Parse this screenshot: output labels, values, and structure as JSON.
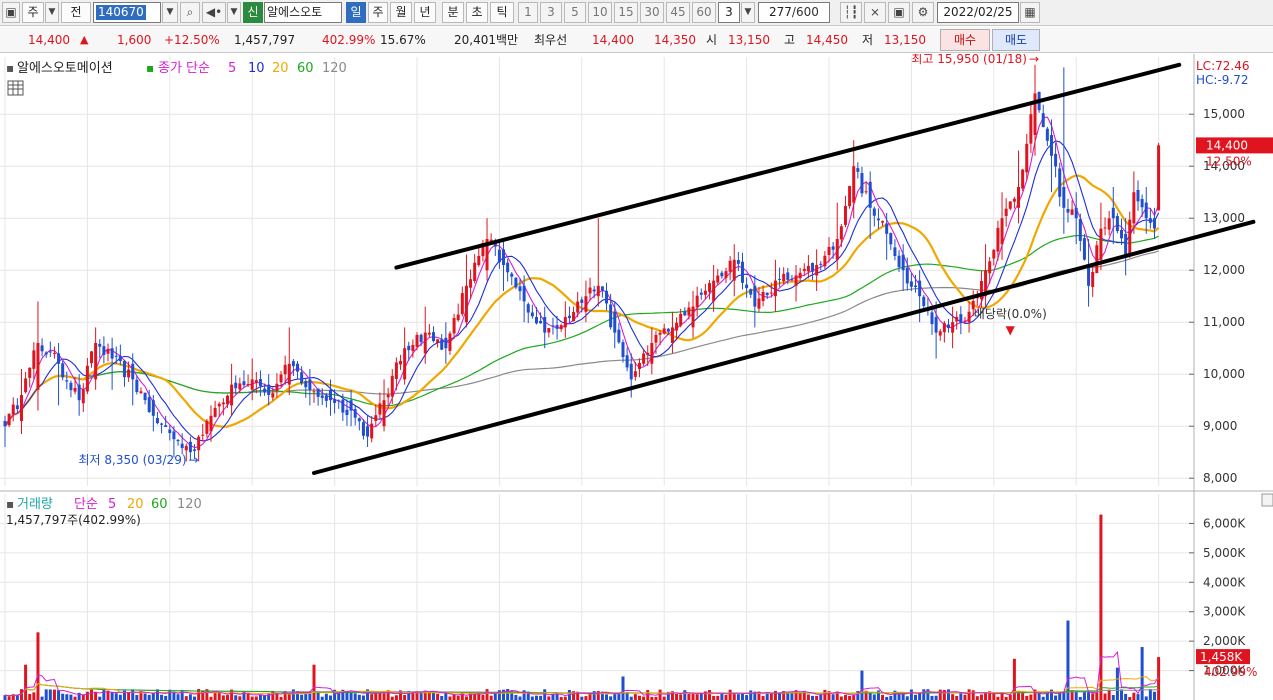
{
  "toolbar": {
    "market": "주",
    "type": "전",
    "code": "140670",
    "badge": "신",
    "name": "알에스오토",
    "periods": [
      "일",
      "주",
      "월",
      "년",
      "분",
      "초",
      "틱"
    ],
    "active_period": "일",
    "intervals": [
      "1",
      "3",
      "5",
      "10",
      "15",
      "30",
      "45",
      "60"
    ],
    "interval_value": "3",
    "count": "277",
    "count_total": "/600",
    "date": "2022/02/25"
  },
  "quote": {
    "price": "14,400",
    "change": "1,600",
    "change_pct": "+12.50%",
    "volume": "1,457,797",
    "volume_ratio": "402.99%",
    "turnover": "15.67%",
    "amount": "20,401백만",
    "bid_label": "최우선",
    "bid1": "14,400",
    "bid2": "14,350",
    "open_label": "시",
    "open": "13,150",
    "high_label": "고",
    "high": "14,450",
    "low_label": "저",
    "low": "13,150",
    "buy_label": "매수",
    "sell_label": "매도"
  },
  "price_panel": {
    "title": "알에스오토메이션",
    "ma_label": "종가 단순",
    "ma_periods": [
      "5",
      "10",
      "20",
      "60",
      "120"
    ],
    "lc": "LC:72.46",
    "hc": "HC:-9.72",
    "high_annotation": "최고 15,950 (01/18)",
    "low_annotation": "최저 8,350 (03/29)",
    "dividend_annotation": "배당락(0.0%)",
    "current_price_tag": "14,400",
    "current_pct_tag": "12.50%"
  },
  "volume_panel": {
    "title": "거래량",
    "ma_label": "단순",
    "ma_periods": [
      "5",
      "20",
      "60",
      "120"
    ],
    "info": "1,457,797주(402.99%)",
    "current_tag": "1,458K",
    "current_pct_tag": "402.99%"
  },
  "colors": {
    "up": "#e0141e",
    "down": "#1f4fd0",
    "ma5": "#d61fd6",
    "ma10": "#1f2fd6",
    "ma20": "#f0a800",
    "ma60": "#1ea81e",
    "ma120": "#8a8a8a",
    "trendline": "#000000",
    "grid": "#e6e6e6"
  },
  "chart_data": [
    {
      "type": "candlestick",
      "title": "알에스오토메이션",
      "ylim": [
        7850,
        16100
      ],
      "y_ticks": [
        8000,
        9000,
        10000,
        11000,
        12000,
        13000,
        14000,
        15000
      ],
      "grid": true,
      "anchors": [
        {
          "i": 0,
          "close": 9000,
          "open": 9100,
          "high": 9200,
          "low": 8600
        },
        {
          "i": 4,
          "close": 9600,
          "open": 9100,
          "high": 10100,
          "low": 8850
        },
        {
          "i": 8,
          "close": 10600,
          "open": 9700,
          "high": 11400,
          "low": 9300
        },
        {
          "i": 13,
          "close": 10200,
          "open": 10400,
          "high": 10600,
          "low": 9400
        },
        {
          "i": 18,
          "close": 9500,
          "open": 9800,
          "high": 10000,
          "low": 9200
        },
        {
          "i": 22,
          "close": 10600,
          "open": 9900,
          "high": 10900,
          "low": 9700
        },
        {
          "i": 26,
          "close": 10300,
          "open": 10500,
          "high": 10700,
          "low": 9700
        },
        {
          "i": 31,
          "close": 9900,
          "open": 10200,
          "high": 10400,
          "low": 9400
        },
        {
          "i": 36,
          "close": 9200,
          "open": 9500,
          "high": 9600,
          "low": 8900
        },
        {
          "i": 41,
          "close": 8750,
          "open": 8900,
          "high": 9000,
          "low": 8400
        },
        {
          "i": 45,
          "close": 8500,
          "open": 8700,
          "high": 8800,
          "low": 8350
        },
        {
          "i": 50,
          "close": 9200,
          "open": 8900,
          "high": 9400,
          "low": 8700
        },
        {
          "i": 55,
          "close": 9800,
          "open": 9400,
          "high": 10200,
          "low": 9200
        },
        {
          "i": 60,
          "close": 9900,
          "open": 9700,
          "high": 10300,
          "low": 9500
        },
        {
          "i": 64,
          "close": 9600,
          "open": 9800,
          "high": 10000,
          "low": 9400
        },
        {
          "i": 69,
          "close": 10200,
          "open": 9800,
          "high": 10900,
          "low": 9600
        },
        {
          "i": 74,
          "close": 9700,
          "open": 9900,
          "high": 10100,
          "low": 9400
        },
        {
          "i": 79,
          "close": 9500,
          "open": 9700,
          "high": 9900,
          "low": 9200
        },
        {
          "i": 84,
          "close": 9300,
          "open": 9500,
          "high": 9700,
          "low": 9000
        },
        {
          "i": 88,
          "close": 8800,
          "open": 9000,
          "high": 9200,
          "low": 8600
        },
        {
          "i": 92,
          "close": 9500,
          "open": 9000,
          "high": 9900,
          "low": 8900
        },
        {
          "i": 97,
          "close": 10500,
          "open": 9900,
          "high": 10900,
          "low": 9800
        },
        {
          "i": 102,
          "close": 10800,
          "open": 10400,
          "high": 11300,
          "low": 10200
        },
        {
          "i": 107,
          "close": 10500,
          "open": 10700,
          "high": 11000,
          "low": 10200
        },
        {
          "i": 112,
          "close": 11700,
          "open": 11000,
          "high": 12300,
          "low": 10900
        },
        {
          "i": 117,
          "close": 12600,
          "open": 12000,
          "high": 13000,
          "low": 11800
        },
        {
          "i": 121,
          "close": 12100,
          "open": 12400,
          "high": 12600,
          "low": 11600
        },
        {
          "i": 126,
          "close": 11400,
          "open": 11700,
          "high": 11900,
          "low": 11000
        },
        {
          "i": 131,
          "close": 10800,
          "open": 11100,
          "high": 11300,
          "low": 10500
        },
        {
          "i": 136,
          "close": 11100,
          "open": 10900,
          "high": 11400,
          "low": 10700
        },
        {
          "i": 141,
          "close": 11500,
          "open": 11200,
          "high": 11800,
          "low": 11000
        },
        {
          "i": 144,
          "close": 11700,
          "open": 11500,
          "high": 13000,
          "low": 11300
        },
        {
          "i": 148,
          "close": 10800,
          "open": 11200,
          "high": 11400,
          "low": 10500
        },
        {
          "i": 152,
          "close": 9900,
          "open": 10200,
          "high": 10400,
          "low": 9550
        },
        {
          "i": 157,
          "close": 10600,
          "open": 10200,
          "high": 10900,
          "low": 10000
        },
        {
          "i": 162,
          "close": 10900,
          "open": 10600,
          "high": 11200,
          "low": 10400
        },
        {
          "i": 167,
          "close": 11300,
          "open": 10900,
          "high": 11600,
          "low": 10700
        },
        {
          "i": 172,
          "close": 11800,
          "open": 11400,
          "high": 12100,
          "low": 11200
        },
        {
          "i": 177,
          "close": 12200,
          "open": 11800,
          "high": 12500,
          "low": 11500
        },
        {
          "i": 182,
          "close": 11300,
          "open": 11700,
          "high": 11900,
          "low": 10900
        },
        {
          "i": 187,
          "close": 11800,
          "open": 11500,
          "high": 12200,
          "low": 11200
        },
        {
          "i": 192,
          "close": 11900,
          "open": 11700,
          "high": 12100,
          "low": 11400
        },
        {
          "i": 197,
          "close": 12100,
          "open": 11900,
          "high": 12400,
          "low": 11600
        },
        {
          "i": 202,
          "close": 12600,
          "open": 12200,
          "high": 13300,
          "low": 12000
        },
        {
          "i": 206,
          "close": 14000,
          "open": 13300,
          "high": 14500,
          "low": 13000
        },
        {
          "i": 210,
          "close": 13200,
          "open": 13700,
          "high": 13900,
          "low": 12600
        },
        {
          "i": 214,
          "close": 12700,
          "open": 12900,
          "high": 13100,
          "low": 12200
        },
        {
          "i": 218,
          "close": 12000,
          "open": 12300,
          "high": 12500,
          "low": 11600
        },
        {
          "i": 222,
          "close": 11500,
          "open": 11800,
          "high": 12000,
          "low": 11000
        },
        {
          "i": 226,
          "close": 10800,
          "open": 11100,
          "high": 11400,
          "low": 10300
        },
        {
          "i": 230,
          "close": 11000,
          "open": 10800,
          "high": 11300,
          "low": 10500
        },
        {
          "i": 234,
          "close": 11200,
          "open": 11000,
          "high": 11400,
          "low": 10800
        },
        {
          "i": 238,
          "close": 12000,
          "open": 11500,
          "high": 12500,
          "low": 11300
        },
        {
          "i": 242,
          "close": 13000,
          "open": 12500,
          "high": 13500,
          "low": 12200
        },
        {
          "i": 246,
          "close": 13600,
          "open": 13200,
          "high": 14300,
          "low": 12900
        },
        {
          "i": 250,
          "close": 15400,
          "open": 14600,
          "high": 15950,
          "low": 14200
        },
        {
          "i": 254,
          "close": 14200,
          "open": 14600,
          "high": 14900,
          "low": 13500
        },
        {
          "i": 257,
          "close": 13200,
          "open": 13600,
          "high": 15900,
          "low": 12700
        },
        {
          "i": 260,
          "close": 13000,
          "open": 13200,
          "high": 13500,
          "low": 12500
        },
        {
          "i": 263,
          "close": 11700,
          "open": 12100,
          "high": 12600,
          "low": 11300
        },
        {
          "i": 266,
          "close": 12800,
          "open": 12200,
          "high": 13300,
          "low": 12000
        },
        {
          "i": 269,
          "close": 13000,
          "open": 13200,
          "high": 13600,
          "low": 12500
        },
        {
          "i": 272,
          "close": 12300,
          "open": 12700,
          "high": 13000,
          "low": 11900
        },
        {
          "i": 274,
          "close": 13500,
          "open": 12900,
          "high": 13900,
          "low": 12700
        },
        {
          "i": 277,
          "close": 13000,
          "open": 13300,
          "high": 13600,
          "low": 12700
        },
        {
          "i": 279,
          "close": 12800,
          "open": 13000,
          "high": 13200,
          "low": 12600
        },
        {
          "i": 280,
          "close": 14400,
          "open": 13150,
          "high": 14450,
          "low": 13150
        }
      ],
      "trendlines": [
        {
          "from": {
            "i": 95,
            "price": 12050
          },
          "to": {
            "i": 285,
            "price": 15950
          }
        },
        {
          "from": {
            "i": 75,
            "price": 8100
          },
          "to": {
            "i": 303,
            "price": 12930
          }
        }
      ],
      "annotations": [
        {
          "text_key": "high_annotation",
          "i": 250,
          "price": 15950
        },
        {
          "text_key": "low_annotation",
          "i": 46,
          "price": 8350
        },
        {
          "text_key": "dividend_annotation",
          "i": 244,
          "price": 13200
        }
      ]
    },
    {
      "type": "bar",
      "title": "거래량",
      "ylim": [
        0,
        7000000
      ],
      "y_ticks_labels": [
        "1,000K",
        "2,000K",
        "3,000K",
        "4,000K",
        "5,000K",
        "6,000K"
      ],
      "y_ticks": [
        1000000,
        2000000,
        3000000,
        4000000,
        5000000,
        6000000
      ],
      "base_volume": 250000,
      "spikes": [
        {
          "i": 8,
          "v": 2300000
        },
        {
          "i": 5,
          "v": 1200000
        },
        {
          "i": 75,
          "v": 1200000
        },
        {
          "i": 150,
          "v": 800000
        },
        {
          "i": 208,
          "v": 1000000
        },
        {
          "i": 245,
          "v": 1400000
        },
        {
          "i": 258,
          "v": 2700000
        },
        {
          "i": 266,
          "v": 6300000
        },
        {
          "i": 270,
          "v": 1100000
        },
        {
          "i": 276,
          "v": 1800000
        },
        {
          "i": 280,
          "v": 1458000
        }
      ]
    }
  ]
}
